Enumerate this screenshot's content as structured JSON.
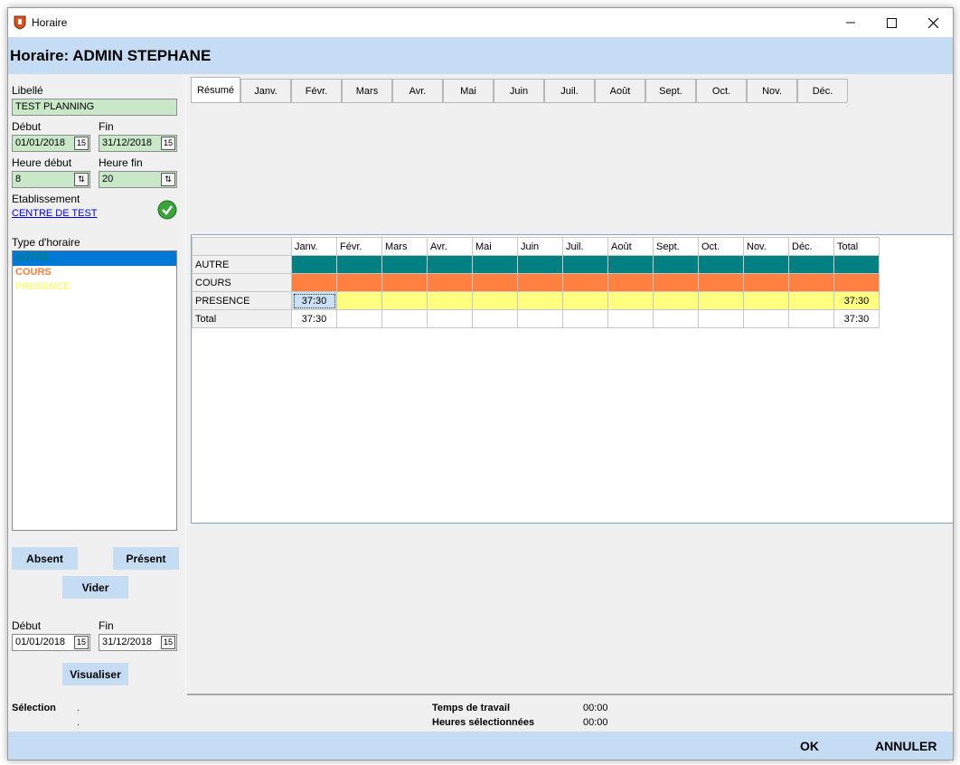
{
  "window": {
    "title": "Horaire"
  },
  "header": {
    "title": "Horaire: ADMIN STEPHANE"
  },
  "form": {
    "libelle_label": "Libellé",
    "libelle_value": "TEST PLANNING",
    "debut_label": "Début",
    "debut_value": "01/01/2018",
    "fin_label": "Fin",
    "fin_value": "31/12/2018",
    "heure_debut_label": "Heure début",
    "heure_debut_value": "8",
    "heure_fin_label": "Heure fin",
    "heure_fin_value": "20",
    "etablissement_label": "Etablissement",
    "etablissement_value": "CENTRE DE TEST",
    "type_label": "Type d'horaire"
  },
  "type_list": [
    {
      "label": "AUTRE",
      "color": "#008080",
      "selected": true
    },
    {
      "label": "COURS",
      "color": "#ff8040",
      "selected": false
    },
    {
      "label": "PRESENCE",
      "color": "#ffff80",
      "selected": false
    }
  ],
  "actions": {
    "absent": "Absent",
    "present": "Présent",
    "vider": "Vider",
    "visualiser": "Visualiser"
  },
  "range": {
    "debut_label": "Début",
    "debut_value": "01/01/2018",
    "fin_label": "Fin",
    "fin_value": "31/12/2018"
  },
  "tabs": [
    "Résumé",
    "Janv.",
    "Févr.",
    "Mars",
    "Avr.",
    "Mai",
    "Juin",
    "Juil.",
    "Août",
    "Sept.",
    "Oct.",
    "Nov.",
    "Déc."
  ],
  "active_tab": 0,
  "grid": {
    "columns": [
      "Janv.",
      "Févr.",
      "Mars",
      "Avr.",
      "Mai",
      "Juin",
      "Juil.",
      "Août",
      "Sept.",
      "Oct.",
      "Nov.",
      "Déc.",
      "Total"
    ],
    "rows": [
      {
        "label": "AUTRE",
        "color": "#008080",
        "values": [
          "",
          "",
          "",
          "",
          "",
          "",
          "",
          "",
          "",
          "",
          "",
          "",
          ""
        ]
      },
      {
        "label": "COURS",
        "color": "#ff8040",
        "values": [
          "",
          "",
          "",
          "",
          "",
          "",
          "",
          "",
          "",
          "",
          "",
          "",
          ""
        ]
      },
      {
        "label": "PRESENCE",
        "color": "#ffff80",
        "values": [
          "37:30",
          "",
          "",
          "",
          "",
          "",
          "",
          "",
          "",
          "",
          "",
          "",
          "37:30"
        ]
      },
      {
        "label": "Total",
        "color": "",
        "values": [
          "37:30",
          "",
          "",
          "",
          "",
          "",
          "",
          "",
          "",
          "",
          "",
          "",
          "37:30"
        ]
      }
    ]
  },
  "footer": {
    "selection_label": "Sélection",
    "selection_dot1": ".",
    "selection_dot2": ".",
    "temps_label": "Temps de travail",
    "temps_value": "00:00",
    "heures_label": "Heures sélectionnées",
    "heures_value": "00:00"
  },
  "bottom": {
    "ok": "OK",
    "annuler": "ANNULER"
  }
}
